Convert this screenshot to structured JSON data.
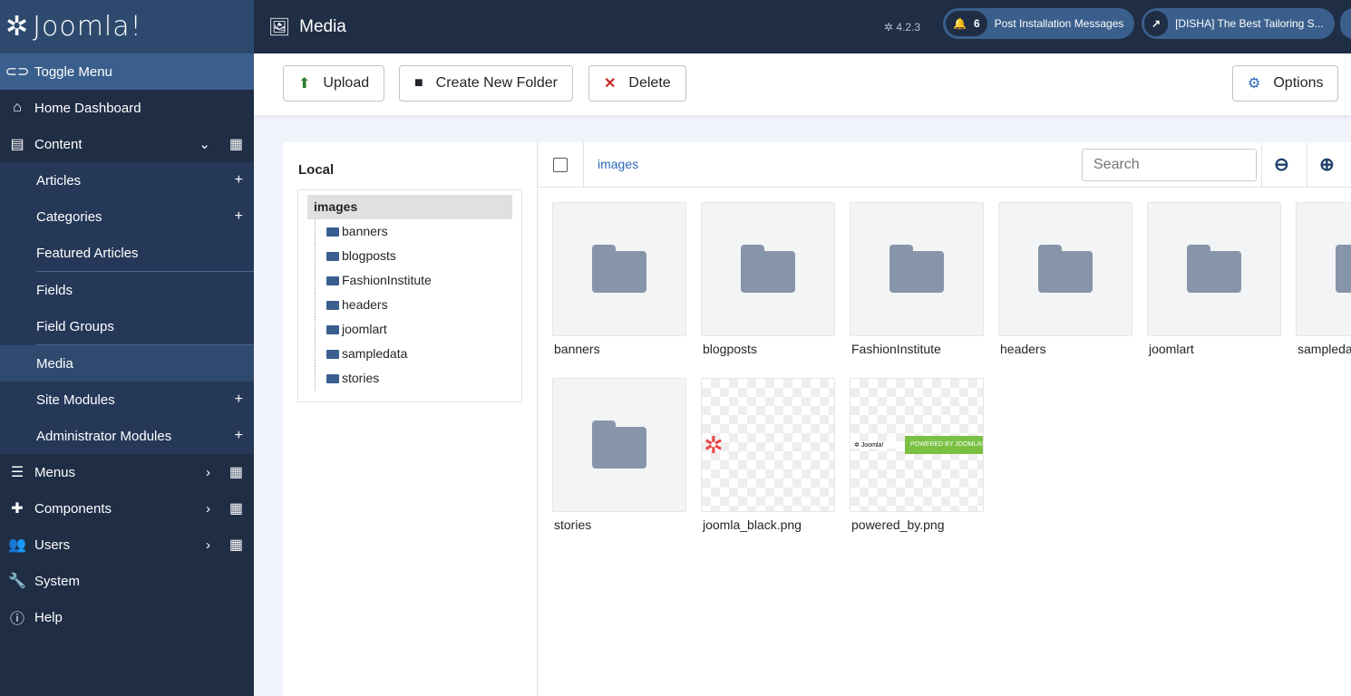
{
  "logo": "Joomla!",
  "sidebar": {
    "items": [
      {
        "label": "Toggle Menu",
        "icon": "toggle-icon"
      },
      {
        "label": "Home Dashboard",
        "icon": "home-icon"
      },
      {
        "label": "Content",
        "icon": "file-icon"
      },
      {
        "label": "Articles"
      },
      {
        "label": "Categories"
      },
      {
        "label": "Featured Articles"
      },
      {
        "label": "Fields"
      },
      {
        "label": "Field Groups"
      },
      {
        "label": "Media"
      },
      {
        "label": "Site Modules"
      },
      {
        "label": "Administrator Modules"
      },
      {
        "label": "Menus",
        "icon": "list-icon"
      },
      {
        "label": "Components",
        "icon": "puzzle-icon"
      },
      {
        "label": "Users",
        "icon": "users-icon"
      },
      {
        "label": "System",
        "icon": "wrench-icon"
      },
      {
        "label": "Help",
        "icon": "info-icon"
      }
    ]
  },
  "header": {
    "title": "Media",
    "version": "4.2.3",
    "notif_count": "6",
    "notif_label": "Post Installation Messages",
    "site_label": "[DISHA] The Best Tailoring S..."
  },
  "toolbar": {
    "upload": "Upload",
    "new_folder": "Create New Folder",
    "delete": "Delete",
    "options": "Options"
  },
  "tree": {
    "heading": "Local",
    "root": "images",
    "children": [
      "banners",
      "blogposts",
      "FashionInstitute",
      "headers",
      "joomlart",
      "sampledata",
      "stories"
    ]
  },
  "browser": {
    "breadcrumb": "images",
    "search_placeholder": "Search",
    "items": [
      {
        "name": "banners",
        "type": "folder"
      },
      {
        "name": "blogposts",
        "type": "folder"
      },
      {
        "name": "FashionInstitute",
        "type": "folder"
      },
      {
        "name": "headers",
        "type": "folder"
      },
      {
        "name": "joomlart",
        "type": "folder"
      },
      {
        "name": "sampledata",
        "type": "folder"
      },
      {
        "name": "stories",
        "type": "folder"
      },
      {
        "name": "joomla_black.png",
        "type": "image"
      },
      {
        "name": "powered_by.png",
        "type": "image"
      }
    ]
  },
  "powered_text": "POWERED BY JOOMLA!",
  "colors": {
    "sidebar": "#1f2d45",
    "accent": "#3b5f8c",
    "green": "#7ac143"
  }
}
